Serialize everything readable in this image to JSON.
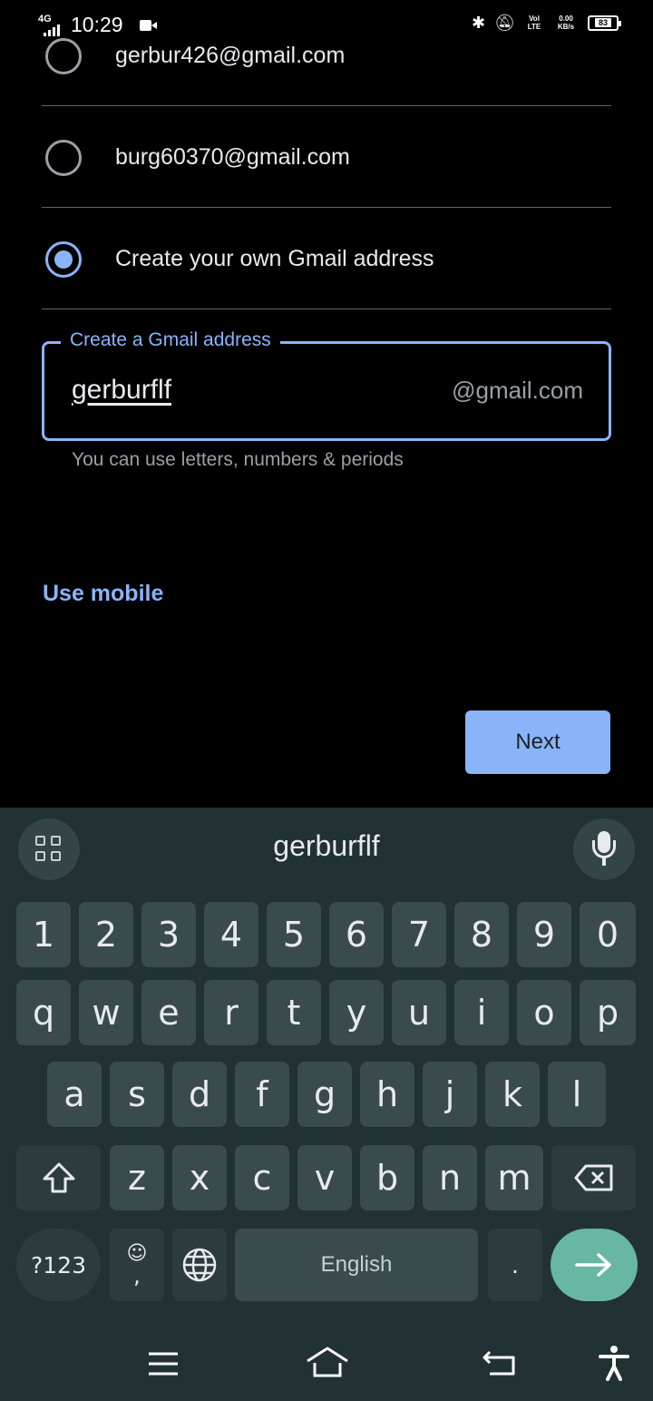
{
  "status_bar": {
    "network": "4G",
    "time": "10:29",
    "volte": "Vol LTE",
    "speed": "0.00 KB/s",
    "battery": "83"
  },
  "accounts": {
    "options": [
      {
        "label": "gerbur426@gmail.com",
        "selected": false
      },
      {
        "label": "burg60370@gmail.com",
        "selected": false
      },
      {
        "label": "Create your own Gmail address",
        "selected": true
      }
    ]
  },
  "gmail_field": {
    "label": "Create a Gmail address",
    "value": "gerburflf",
    "suffix": "@gmail.com",
    "helper": "You can use letters, numbers & periods"
  },
  "use_mobile_label": "Use mobile",
  "next_label": "Next",
  "keyboard": {
    "suggestion": "gerburflf",
    "number_row": [
      "1",
      "2",
      "3",
      "4",
      "5",
      "6",
      "7",
      "8",
      "9",
      "0"
    ],
    "row1": [
      "q",
      "w",
      "e",
      "r",
      "t",
      "y",
      "u",
      "i",
      "o",
      "p"
    ],
    "row2": [
      "a",
      "s",
      "d",
      "f",
      "g",
      "h",
      "j",
      "k",
      "l"
    ],
    "row3": [
      "z",
      "x",
      "c",
      "v",
      "b",
      "n",
      "m"
    ],
    "symbols_label": "?123",
    "space_label": "English",
    "period_label": ".",
    "emoji_sub": ","
  },
  "icons": {
    "grid": "grid-icon",
    "mic": "microphone-icon",
    "shift": "shift-icon",
    "backspace": "backspace-icon",
    "globe": "globe-icon",
    "enter": "arrow-right-icon",
    "menu": "menu-icon",
    "home": "home-icon",
    "back": "back-icon",
    "accessibility": "accessibility-icon"
  },
  "colors": {
    "accent": "#8ab4f8",
    "keyboard_bg": "#223133",
    "key_bg": "#3a4b4d",
    "enter_key": "#67b7a3"
  }
}
